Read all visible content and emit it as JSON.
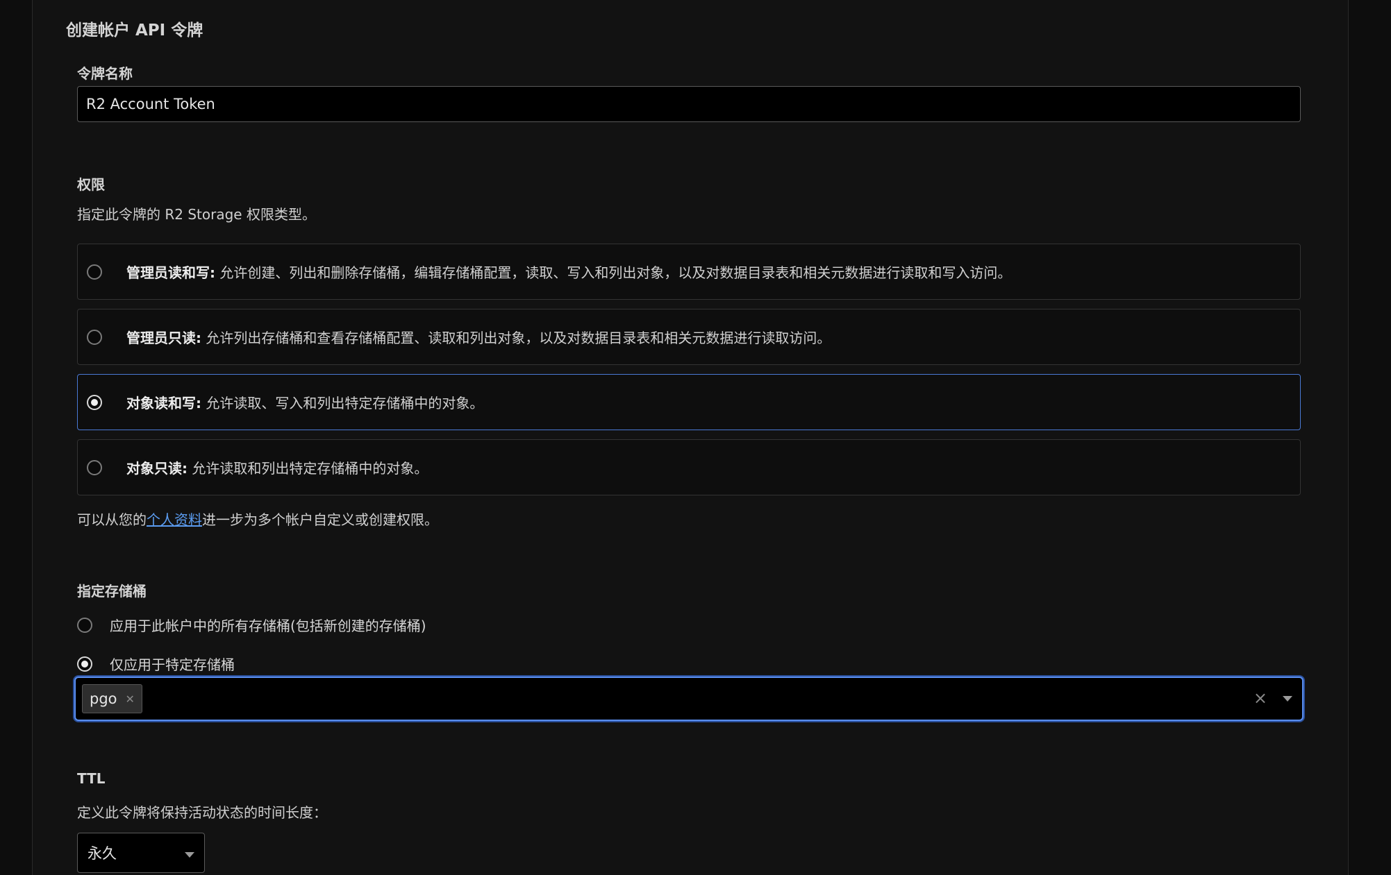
{
  "page": {
    "title": "创建帐户 API 令牌"
  },
  "token_name": {
    "label": "令牌名称",
    "value": "R2 Account Token"
  },
  "permissions": {
    "label": "权限",
    "description": "指定此令牌的 R2 Storage 权限类型。",
    "options": [
      {
        "title": "管理员读和写:",
        "text": " 允许创建、列出和删除存储桶，编辑存储桶配置，读取、写入和列出对象，以及对数据目录表和相关元数据进行读取和写入访问。",
        "selected": false
      },
      {
        "title": "管理员只读:",
        "text": " 允许列出存储桶和查看存储桶配置、读取和列出对象，以及对数据目录表和相关元数据进行读取访问。",
        "selected": false
      },
      {
        "title": "对象读和写:",
        "text": " 允许读取、写入和列出特定存储桶中的对象。",
        "selected": true
      },
      {
        "title": "对象只读:",
        "text": " 允许读取和列出特定存储桶中的对象。",
        "selected": false
      }
    ],
    "note_prefix": "可以从您的",
    "note_link": "个人资料",
    "note_suffix": "进一步为多个帐户自定义或创建权限。"
  },
  "buckets": {
    "label": "指定存储桶",
    "option_all": "应用于此帐户中的所有存储桶(包括新创建的存储桶)",
    "option_specific": "仅应用于特定存储桶",
    "selected_option": "specific",
    "selected_tags": [
      "pgo"
    ]
  },
  "ttl": {
    "label": "TTL",
    "description": "定义此令牌将保持活动状态的时间长度：",
    "value": "永久"
  },
  "colors": {
    "background": "#0d0d0d",
    "panel": "#121212",
    "accent": "#5b8ff0",
    "link": "#5b9cf0"
  }
}
